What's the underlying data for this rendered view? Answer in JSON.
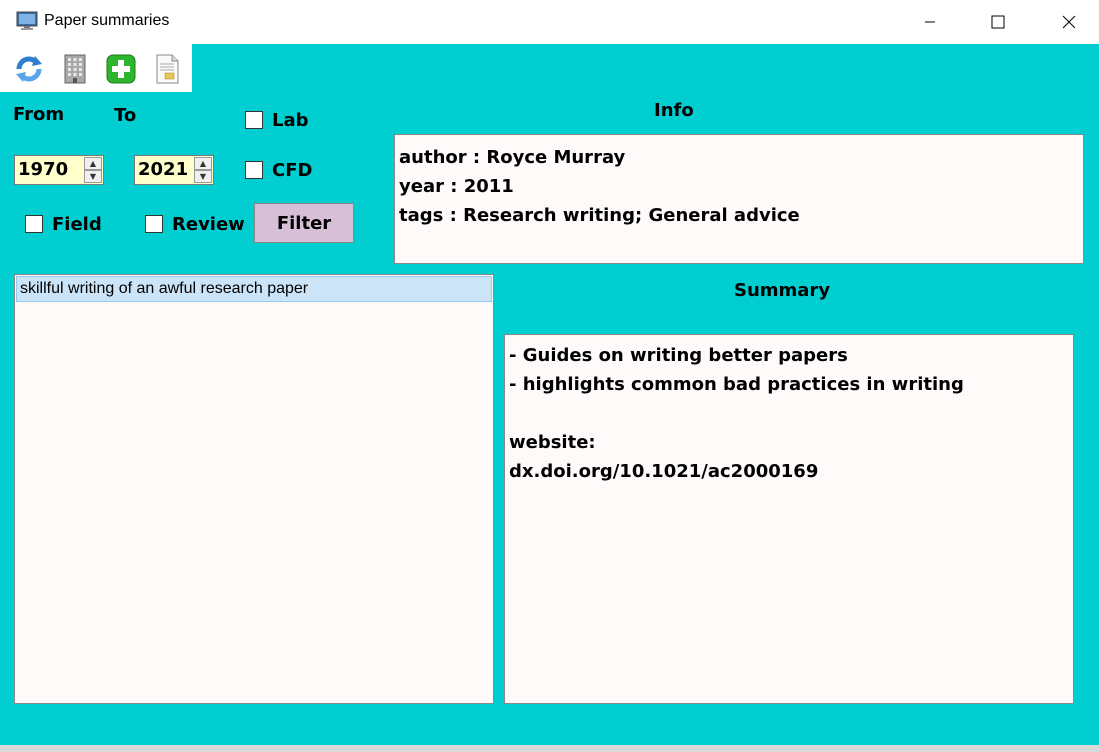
{
  "window": {
    "title": "Paper summaries"
  },
  "toolbar": {
    "icons": [
      "refresh-icon",
      "building-icon",
      "add-icon",
      "document-icon"
    ]
  },
  "filters": {
    "from_label": "From",
    "to_label": "To",
    "from_value": "1970",
    "to_value": "2021",
    "checkboxes": {
      "lab": "Lab",
      "cfd": "CFD",
      "field": "Field",
      "review": "Review"
    },
    "filter_button": "Filter"
  },
  "info": {
    "heading": "Info",
    "lines": [
      "author : Royce Murray",
      "year : 2011",
      "tags : Research writing; General advice"
    ]
  },
  "papers": {
    "items": [
      "skillful writing of an awful research paper"
    ]
  },
  "summary": {
    "heading": "Summary",
    "lines": [
      "- Guides on writing better papers",
      "- highlights common bad practices in writing",
      "",
      "website:",
      "dx.doi.org/10.1021/ac2000169"
    ]
  },
  "colors": {
    "background": "#00ced1",
    "filter_button": "#d8bfd8",
    "spinbox": "#ffffcc",
    "selection": "#cce4f7"
  }
}
